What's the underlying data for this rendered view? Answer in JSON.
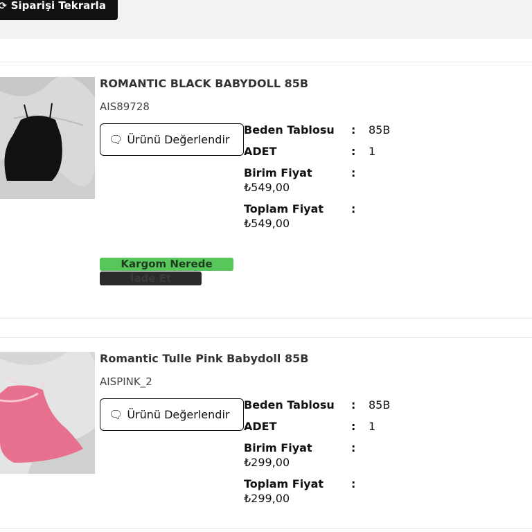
{
  "header": {
    "repeat_order_label": "Siparişi Tekrarla",
    "repeat_icon": "refresh-icon"
  },
  "items": [
    {
      "title": "ROMANTIC BLACK BABYDOLL 85B",
      "sku": "AIS89728",
      "review_label": "Ürünü Değerlendir",
      "size_label": "Beden Tablosu",
      "size_value": "85B",
      "qty_label": "ADET",
      "qty_value": "1",
      "unit_price_label": "Birim Fiyat",
      "unit_price_value": "₺549,00",
      "total_price_label": "Toplam Fiyat",
      "total_price_value": "₺549,00",
      "track_label": "Kargom Nerede",
      "return_label": "İade Et",
      "image_color": "#111111"
    },
    {
      "title": "Romantic Tulle Pink Babydoll 85B",
      "sku": "AISPINK_2",
      "review_label": "Ürünü Değerlendir",
      "size_label": "Beden Tablosu",
      "size_value": "85B",
      "qty_label": "ADET",
      "qty_value": "1",
      "unit_price_label": "Birim Fiyat",
      "unit_price_value": "₺299,00",
      "total_price_label": "Toplam Fiyat",
      "total_price_value": "₺299,00",
      "image_color": "#e8708f"
    }
  ],
  "colors": {
    "track_button": "#57c75b",
    "return_button": "#2b2b2b",
    "header_bg": "#f2f2f2"
  }
}
